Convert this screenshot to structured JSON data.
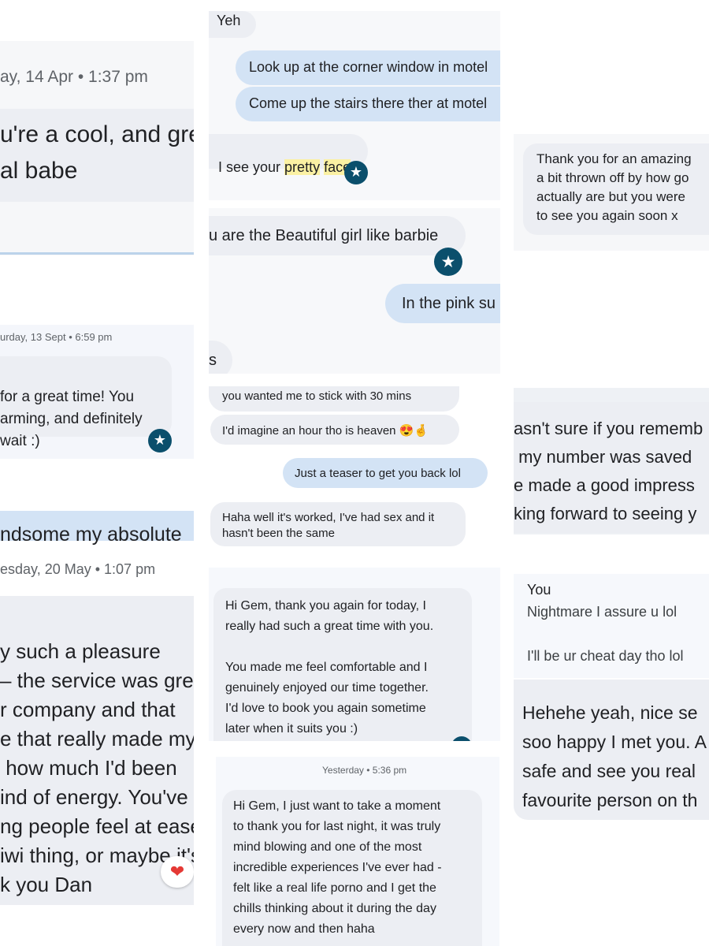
{
  "p1": {
    "timestamp": "ay, 14 Apr • 1:37 pm",
    "msg_line1": "u're a cool, and gre",
    "msg_line2": "al babe"
  },
  "p2": {
    "timestamp": "urday, 13 Sept • 6:59 pm",
    "msg": "for a great time! You\narming, and definitely\n wait :)"
  },
  "p3": {
    "header": "ndsome my absolute",
    "timestamp": "esday, 20 May • 1:07 pm",
    "lines": [
      "y such a pleasure",
      "– the service was great",
      "r company and that",
      "e that really made my c",
      " how much I'd been",
      "ind of energy. You've go",
      "ng people feel at ease.",
      "iwi thing, or maybe it's",
      "k you Dan"
    ],
    "reaction": "❤️"
  },
  "p4": {
    "m1": "Yeh",
    "m2": "Look up at the corner window in motel",
    "m3": "Come up the stairs there ther at motel",
    "m4_before": "I see your ",
    "m4_hl1": "pretty",
    "m4_mid": " ",
    "m4_hl2": "face",
    "m5": "u are the Beautiful girl like barbie",
    "m6": "In the pink su",
    "m7": "s"
  },
  "p5": {
    "m0": "you wanted me to stick with 30 mins",
    "m1": "I'd imagine an hour tho is heaven 😍🤞",
    "m2": "Just a teaser to get you back lol",
    "m3": "Haha well it's worked, I've had sex and it\nhasn't been the same"
  },
  "p6": {
    "msg": "Hi Gem, thank you again for today, I\nreally had such a great time with you.\n\nYou made me feel comfortable and I\ngenuinely enjoyed our time together.\nI'd love to book you again sometime\nlater when it suits you :)"
  },
  "p7": {
    "timestamp": "Yesterday • 5:36 pm",
    "msg": "Hi Gem, I just want to take a moment\nto thank you for last night, it was truly\nmind blowing and one of the most\nincredible experiences I've ever had -\nfelt like a real life porno and I get the\nchills thinking about it during the day\nevery now and then haha"
  },
  "p8": {
    "msg": "Thank you for an amazing\na bit thrown off by how go\nactually are but you were\nto see you again soon x"
  },
  "p9": {
    "lines": [
      "asn't sure if you rememb",
      " my number was saved",
      "e made a good impress",
      "king forward to seeing y"
    ]
  },
  "p10": {
    "sender": "You",
    "line1": "Nightmare I assure u lol",
    "line2": "I'll be ur cheat day tho lol"
  },
  "p11": {
    "lines": [
      "Hehehe yeah, nice se",
      "soo happy I met you. A",
      "safe and see you real",
      "favourite person on th"
    ]
  },
  "icons": {
    "star": "★",
    "star_name": "star-icon",
    "heart_name": "heart-icon"
  },
  "colors": {
    "sent": "#d3e3f5",
    "received": "#eceef3",
    "star_badge": "#0b4f6c",
    "highlight": "#fbf1a3"
  }
}
